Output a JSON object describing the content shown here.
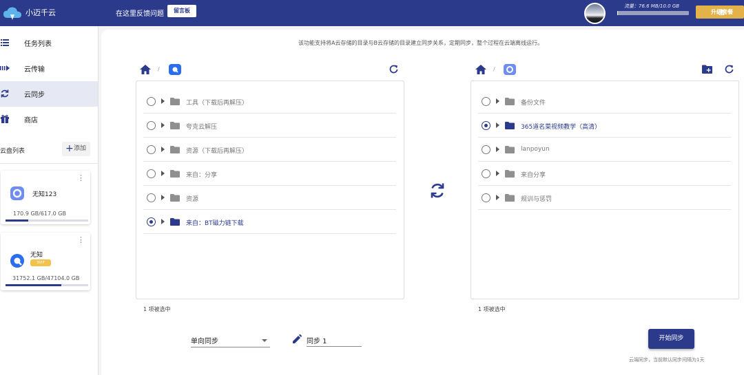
{
  "header": {
    "app_name": "小迈千云",
    "feedback_text": "在这里反馈问题",
    "guestbook_button": "留言板",
    "traffic_text": "流量：76.6 MB/10.0 GB",
    "traffic_fraction": 0.0075,
    "upgrade_button": "升级套餐",
    "color_primary": "#2c3a8c",
    "color_upgrade": "#e3b34a"
  },
  "sidebar": {
    "nav": [
      {
        "label": "任务列表",
        "icon": "list-icon",
        "active": false
      },
      {
        "label": "云传输",
        "icon": "transfer-icon",
        "active": false
      },
      {
        "label": "云同步",
        "icon": "sync-icon",
        "active": true
      },
      {
        "label": "商店",
        "icon": "gift-icon",
        "active": false
      }
    ],
    "disk_list_title": "云盘列表",
    "add_button": "添加",
    "disks": [
      {
        "name": "无知123",
        "usage": "170.9 GB/617.0 GB",
        "fraction": 0.277,
        "icon": "cloud-disk-a-icon"
      },
      {
        "name": "无知",
        "badge": "SVIP",
        "usage": "31752.1 GB/47104.0 GB",
        "fraction": 0.674,
        "icon": "cloud-disk-b-icon"
      }
    ]
  },
  "main": {
    "description": "该功能支持将A云存储的目录与B云存储的目录建立同步关系，定期同步，整个过程在云端离线运行。",
    "left_panel": {
      "crumb_sep": "/",
      "items": [
        {
          "label": "工具（下载后再解压）",
          "selected": false
        },
        {
          "label": "夸克云解压",
          "selected": false
        },
        {
          "label": "资源（下载后再解压）",
          "selected": false
        },
        {
          "label": "来自：分享",
          "selected": false
        },
        {
          "label": "资源",
          "selected": false
        },
        {
          "label": "来自：BT磁力链下载",
          "selected": true
        }
      ],
      "selected_count": "1 项被选中"
    },
    "right_panel": {
      "crumb_sep": "/",
      "items": [
        {
          "label": "备份文件",
          "selected": false
        },
        {
          "label": "365道名菜视频教学（高清）",
          "selected": true
        },
        {
          "label": "lanpoyun",
          "selected": false
        },
        {
          "label": "来自分享",
          "selected": false
        },
        {
          "label": "规训与惩罚",
          "selected": false
        }
      ],
      "selected_count": "1 项被选中"
    },
    "sync_mode": "单向同步",
    "sync_name": "同步 1",
    "start_button": "开始同步",
    "hint": "云端同步，当前默认同步间隔为1天"
  }
}
